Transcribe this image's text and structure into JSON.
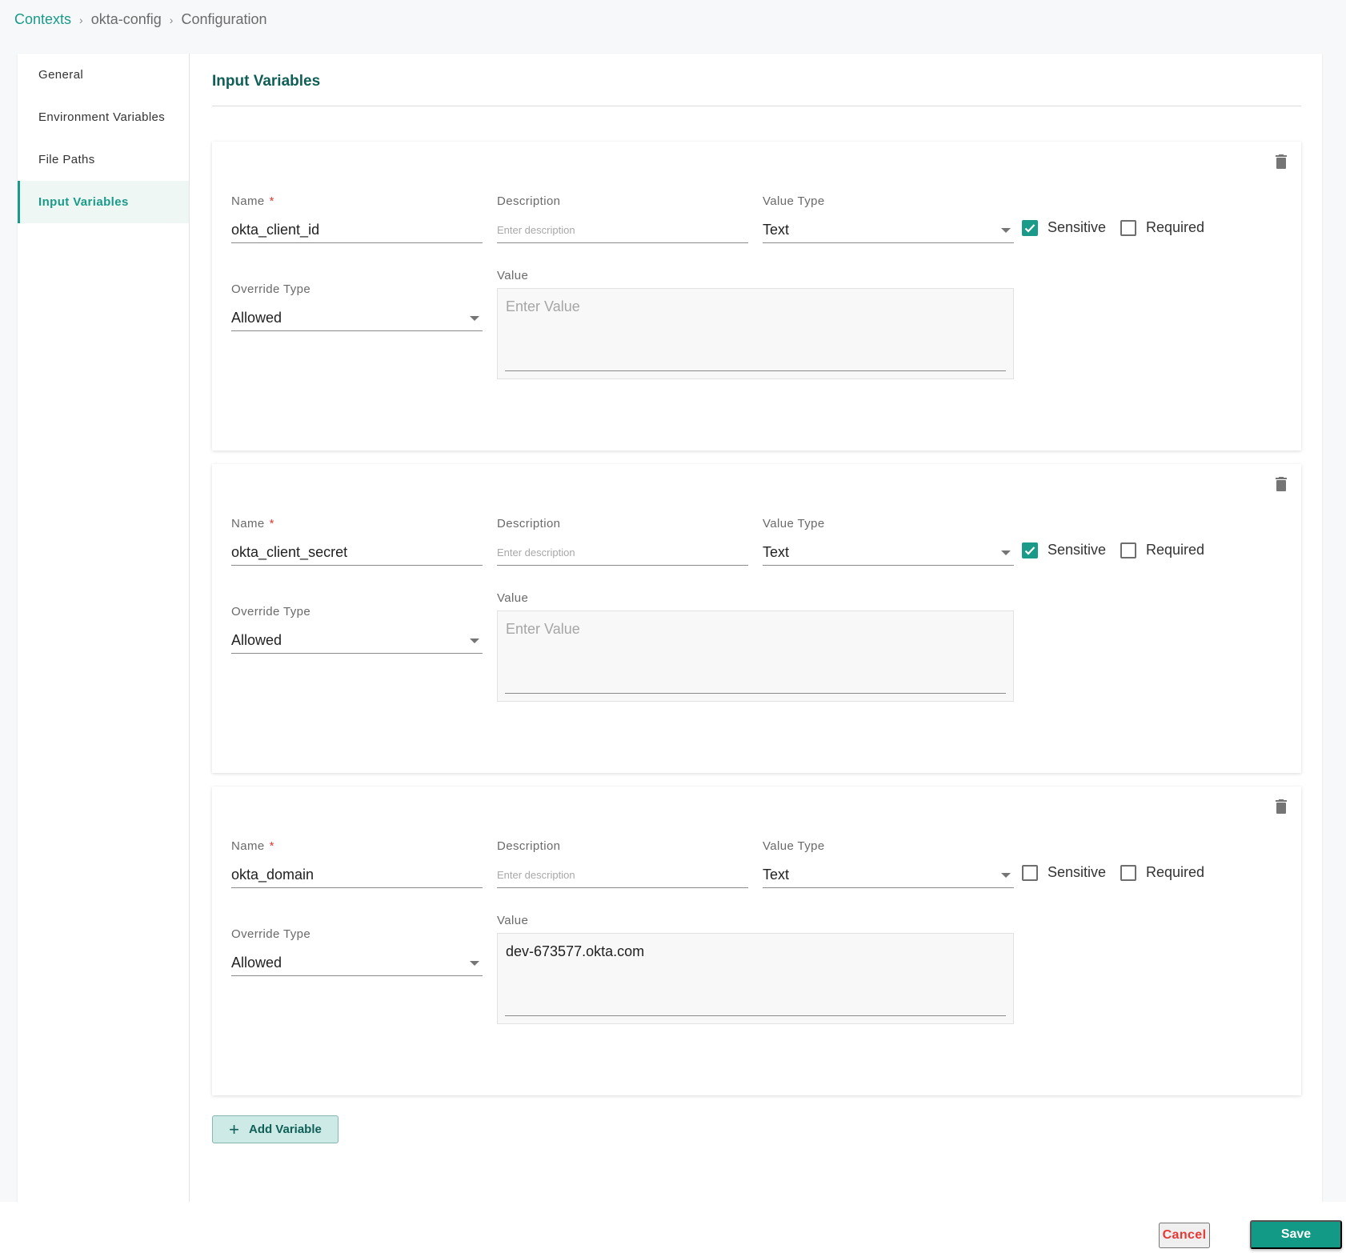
{
  "breadcrumb": {
    "items": [
      "Contexts",
      "okta-config",
      "Configuration"
    ],
    "separator": "›"
  },
  "sidebar": {
    "items": [
      {
        "label": "General",
        "active": false
      },
      {
        "label": "Environment Variables",
        "active": false
      },
      {
        "label": "File Paths",
        "active": false
      },
      {
        "label": "Input Variables",
        "active": true
      }
    ]
  },
  "section": {
    "title": "Input Variables"
  },
  "labels": {
    "name": "Name",
    "required_mark": "*",
    "description": "Description",
    "value_type": "Value Type",
    "override_type": "Override Type",
    "value": "Value",
    "sensitive": "Sensitive",
    "required": "Required",
    "description_placeholder": "Enter description",
    "value_placeholder": "Enter Value"
  },
  "variables": [
    {
      "name": "okta_client_id",
      "description": "",
      "value_type": "Text",
      "sensitive": true,
      "required": false,
      "override_type": "Allowed",
      "value": ""
    },
    {
      "name": "okta_client_secret",
      "description": "",
      "value_type": "Text",
      "sensitive": true,
      "required": false,
      "override_type": "Allowed",
      "value": ""
    },
    {
      "name": "okta_domain",
      "description": "",
      "value_type": "Text",
      "sensitive": false,
      "required": false,
      "override_type": "Allowed",
      "value": "dev-673577.okta.com"
    }
  ],
  "actions": {
    "add_variable": "Add Variable",
    "cancel": "Cancel",
    "save": "Save"
  },
  "colors": {
    "accent": "#1a9a89",
    "title": "#0f5f57",
    "danger": "#e53935",
    "save_bg": "#139a86"
  }
}
